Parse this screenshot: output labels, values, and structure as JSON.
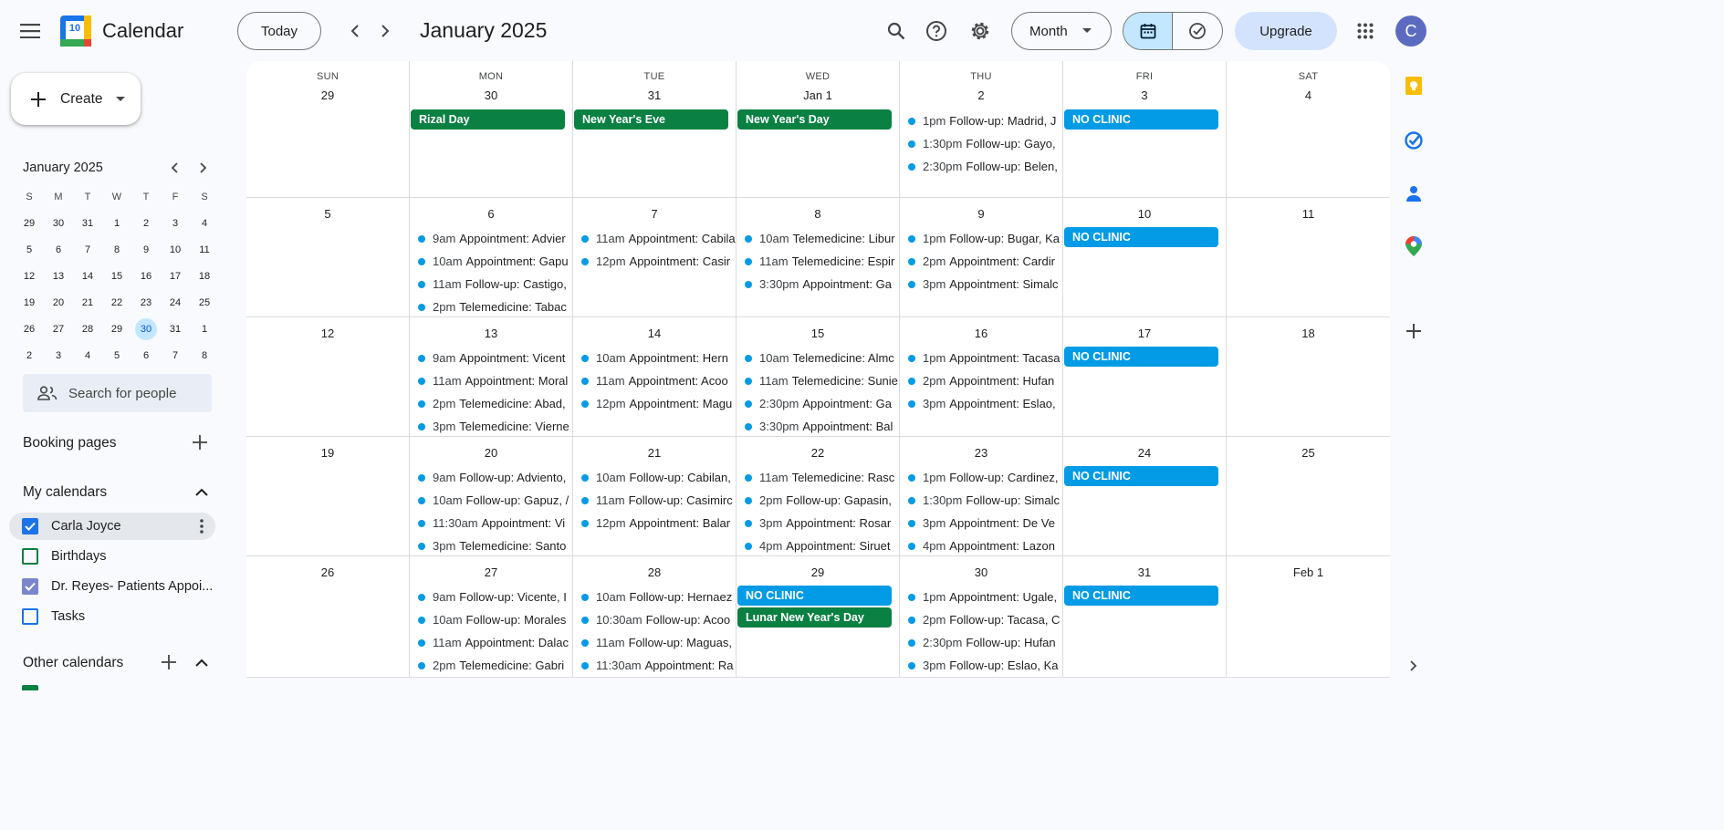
{
  "header": {
    "app_title": "Calendar",
    "logo_day": "10",
    "today_label": "Today",
    "period": "January 2025",
    "view_label": "Month",
    "upgrade_label": "Upgrade",
    "avatar_letter": "C"
  },
  "sidebar": {
    "create_label": "Create",
    "mini_title": "January 2025",
    "mini_headers": [
      "S",
      "M",
      "T",
      "W",
      "T",
      "F",
      "S"
    ],
    "mini_days": [
      "29",
      "30",
      "31",
      "1",
      "2",
      "3",
      "4",
      "5",
      "6",
      "7",
      "8",
      "9",
      "10",
      "11",
      "12",
      "13",
      "14",
      "15",
      "16",
      "17",
      "18",
      "19",
      "20",
      "21",
      "22",
      "23",
      "24",
      "25",
      "26",
      "27",
      "28",
      "29",
      "30",
      "31",
      "1",
      "2",
      "3",
      "4",
      "5",
      "6",
      "7",
      "8"
    ],
    "search_people_placeholder": "Search for people",
    "booking_pages_label": "Booking pages",
    "my_calendars_label": "My calendars",
    "calendars": [
      {
        "name": "Carla Joyce",
        "checked": true,
        "color": "#1a73e8"
      },
      {
        "name": "Birthdays",
        "checked": false,
        "color": "#0b8043"
      },
      {
        "name": "Dr. Reyes- Patients Appoi...",
        "checked": true,
        "color": "#7986cb"
      },
      {
        "name": "Tasks",
        "checked": false,
        "color": "#1a73e8"
      }
    ],
    "other_calendars_label": "Other calendars"
  },
  "month": {
    "weekday_headers": [
      "SUN",
      "MON",
      "TUE",
      "WED",
      "THU",
      "FRI",
      "SAT"
    ],
    "weeks": [
      [
        {
          "day": "29",
          "chips": [],
          "events": []
        },
        {
          "day": "30",
          "chips": [
            {
              "label": "Rizal Day",
              "color": "green"
            }
          ],
          "events": []
        },
        {
          "day": "31",
          "chips": [
            {
              "label": "New Year's Eve",
              "color": "green"
            }
          ],
          "events": []
        },
        {
          "day": "Jan 1",
          "chips": [
            {
              "label": "New Year's Day",
              "color": "green"
            }
          ],
          "events": []
        },
        {
          "day": "2",
          "chips": [],
          "events": [
            {
              "time": "1pm",
              "title": "Follow-up: Madrid, J"
            },
            {
              "time": "1:30pm",
              "title": "Follow-up: Gayo,"
            },
            {
              "time": "2:30pm",
              "title": "Follow-up: Belen,"
            }
          ]
        },
        {
          "day": "3",
          "chips": [
            {
              "label": "NO CLINIC",
              "color": "blue"
            }
          ],
          "events": []
        },
        {
          "day": "4",
          "chips": [],
          "events": []
        }
      ],
      [
        {
          "day": "5",
          "chips": [],
          "events": []
        },
        {
          "day": "6",
          "chips": [],
          "events": [
            {
              "time": "9am",
              "title": "Appointment: Advier"
            },
            {
              "time": "10am",
              "title": "Appointment: Gapu"
            },
            {
              "time": "11am",
              "title": "Follow-up: Castigo,"
            },
            {
              "time": "2pm",
              "title": "Telemedicine: Tabac"
            }
          ]
        },
        {
          "day": "7",
          "chips": [],
          "events": [
            {
              "time": "11am",
              "title": "Appointment: Cabila"
            },
            {
              "time": "12pm",
              "title": "Appointment: Casir"
            }
          ]
        },
        {
          "day": "8",
          "chips": [],
          "events": [
            {
              "time": "10am",
              "title": "Telemedicine: Libur"
            },
            {
              "time": "11am",
              "title": "Telemedicine: Espir"
            },
            {
              "time": "3:30pm",
              "title": "Appointment: Ga"
            }
          ]
        },
        {
          "day": "9",
          "chips": [],
          "events": [
            {
              "time": "1pm",
              "title": "Follow-up: Bugar, Ka"
            },
            {
              "time": "2pm",
              "title": "Appointment: Cardir"
            },
            {
              "time": "3pm",
              "title": "Appointment: Simalc"
            }
          ]
        },
        {
          "day": "10",
          "chips": [
            {
              "label": "NO CLINIC",
              "color": "blue"
            }
          ],
          "events": []
        },
        {
          "day": "11",
          "chips": [],
          "events": []
        }
      ],
      [
        {
          "day": "12",
          "chips": [],
          "events": []
        },
        {
          "day": "13",
          "chips": [],
          "events": [
            {
              "time": "9am",
              "title": "Appointment: Vicent"
            },
            {
              "time": "11am",
              "title": "Appointment: Moral"
            },
            {
              "time": "2pm",
              "title": "Telemedicine: Abad,"
            },
            {
              "time": "3pm",
              "title": "Telemedicine: Vierne"
            }
          ]
        },
        {
          "day": "14",
          "chips": [],
          "events": [
            {
              "time": "10am",
              "title": "Appointment: Hern"
            },
            {
              "time": "11am",
              "title": "Appointment: Acoo"
            },
            {
              "time": "12pm",
              "title": "Appointment: Magu"
            }
          ]
        },
        {
          "day": "15",
          "chips": [],
          "events": [
            {
              "time": "10am",
              "title": "Telemedicine: Almc"
            },
            {
              "time": "11am",
              "title": "Telemedicine: Sunie"
            },
            {
              "time": "2:30pm",
              "title": "Appointment: Ga"
            },
            {
              "time": "3:30pm",
              "title": "Appointment: Bal"
            }
          ]
        },
        {
          "day": "16",
          "chips": [],
          "events": [
            {
              "time": "1pm",
              "title": "Appointment: Tacasa"
            },
            {
              "time": "2pm",
              "title": "Appointment: Hufan"
            },
            {
              "time": "3pm",
              "title": "Appointment: Eslao,"
            }
          ]
        },
        {
          "day": "17",
          "chips": [
            {
              "label": "NO CLINIC",
              "color": "blue"
            }
          ],
          "events": []
        },
        {
          "day": "18",
          "chips": [],
          "events": []
        }
      ],
      [
        {
          "day": "19",
          "chips": [],
          "events": []
        },
        {
          "day": "20",
          "chips": [],
          "events": [
            {
              "time": "9am",
              "title": "Follow-up: Adviento,"
            },
            {
              "time": "10am",
              "title": "Follow-up: Gapuz, /"
            },
            {
              "time": "11:30am",
              "title": "Appointment: Vi"
            },
            {
              "time": "3pm",
              "title": "Telemedicine: Santo"
            }
          ]
        },
        {
          "day": "21",
          "chips": [],
          "events": [
            {
              "time": "10am",
              "title": "Follow-up: Cabilan,"
            },
            {
              "time": "11am",
              "title": "Follow-up: Casimirc"
            },
            {
              "time": "12pm",
              "title": "Appointment: Balar"
            }
          ]
        },
        {
          "day": "22",
          "chips": [],
          "events": [
            {
              "time": "11am",
              "title": "Telemedicine: Rasc"
            },
            {
              "time": "2pm",
              "title": "Follow-up: Gapasin,"
            },
            {
              "time": "3pm",
              "title": "Appointment: Rosar"
            },
            {
              "time": "4pm",
              "title": "Appointment: Siruet"
            }
          ]
        },
        {
          "day": "23",
          "chips": [],
          "events": [
            {
              "time": "1pm",
              "title": "Follow-up: Cardinez,"
            },
            {
              "time": "1:30pm",
              "title": "Follow-up: Simalc"
            },
            {
              "time": "3pm",
              "title": "Appointment: De Ve"
            },
            {
              "time": "4pm",
              "title": "Appointment: Lazon"
            }
          ]
        },
        {
          "day": "24",
          "chips": [
            {
              "label": "NO CLINIC",
              "color": "blue"
            }
          ],
          "events": []
        },
        {
          "day": "25",
          "chips": [],
          "events": []
        }
      ],
      [
        {
          "day": "26",
          "chips": [],
          "events": []
        },
        {
          "day": "27",
          "chips": [],
          "events": [
            {
              "time": "9am",
              "title": "Follow-up: Vicente, I"
            },
            {
              "time": "10am",
              "title": "Follow-up: Morales"
            },
            {
              "time": "11am",
              "title": "Appointment: Dalac"
            },
            {
              "time": "2pm",
              "title": "Telemedicine: Gabri"
            }
          ]
        },
        {
          "day": "28",
          "chips": [],
          "events": [
            {
              "time": "10am",
              "title": "Follow-up: Hernaez"
            },
            {
              "time": "10:30am",
              "title": "Follow-up: Acoo"
            },
            {
              "time": "11am",
              "title": "Follow-up: Maguas,"
            },
            {
              "time": "11:30am",
              "title": "Appointment: Ra"
            }
          ]
        },
        {
          "day": "29",
          "chips": [
            {
              "label": "NO CLINIC",
              "color": "blue"
            },
            {
              "label": "Lunar New Year's Day",
              "color": "green"
            }
          ],
          "events": []
        },
        {
          "day": "30",
          "chips": [],
          "events": [
            {
              "time": "1pm",
              "title": "Appointment: Ugale,"
            },
            {
              "time": "2pm",
              "title": "Follow-up: Tacasa, C"
            },
            {
              "time": "2:30pm",
              "title": "Follow-up: Hufan"
            },
            {
              "time": "3pm",
              "title": "Follow-up: Eslao, Ka"
            }
          ]
        },
        {
          "day": "31",
          "chips": [
            {
              "label": "NO CLINIC",
              "color": "blue"
            }
          ],
          "events": []
        },
        {
          "day": "Feb 1",
          "chips": [],
          "events": []
        }
      ]
    ]
  },
  "colors": {
    "event_dot": "#039be5",
    "holiday": "#0b8043",
    "no_clinic": "#039be5",
    "selected_day": "#c2e7ff",
    "upgrade_bg": "#d3e3fd"
  }
}
